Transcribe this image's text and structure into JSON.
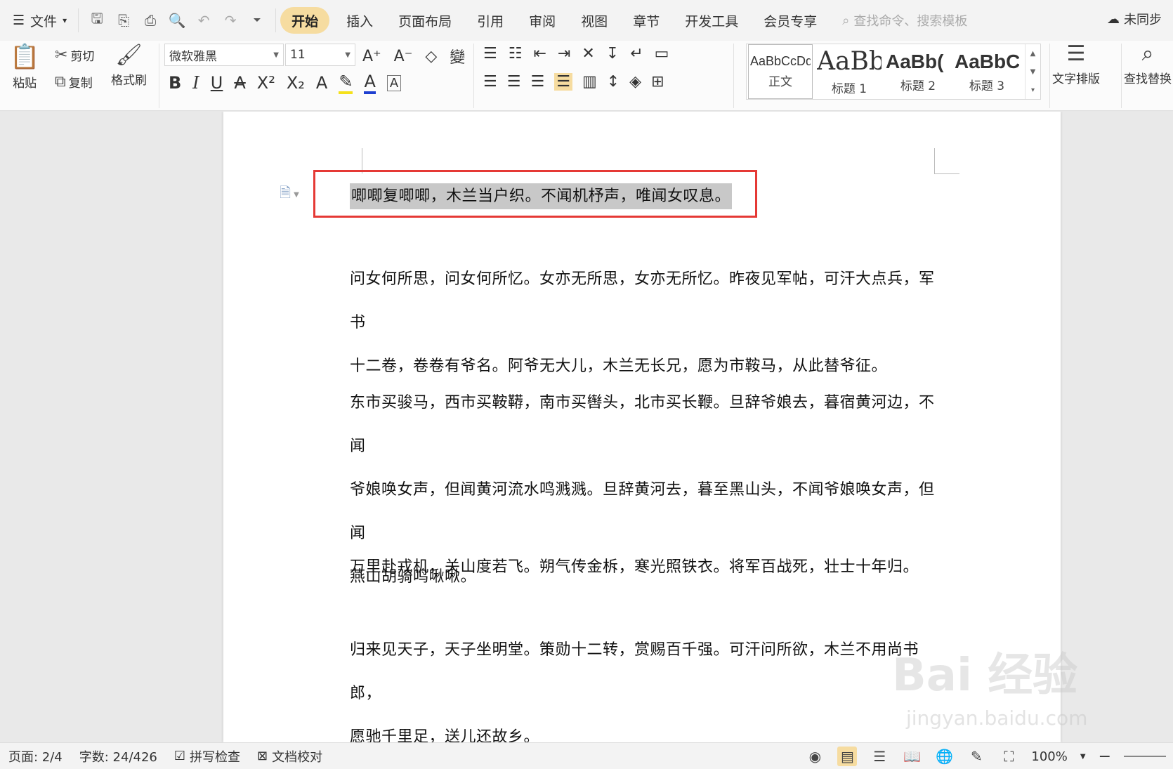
{
  "menubar": {
    "file": "文件",
    "tabs": [
      "开始",
      "插入",
      "页面布局",
      "引用",
      "审阅",
      "视图",
      "章节",
      "开发工具",
      "会员专享"
    ],
    "active_tab": "开始",
    "search_placeholder": "查找命令、搜索模板",
    "sync": "未同步"
  },
  "ribbon": {
    "paste": "粘贴",
    "cut": "剪切",
    "copy": "复制",
    "format_painter": "格式刷",
    "font_name": "微软雅黑",
    "font_size": "11",
    "styles": [
      {
        "sample": "AaBbCcDd",
        "name": "正文"
      },
      {
        "sample": "AaBb",
        "name": "标题 1"
      },
      {
        "sample": "AaBb(",
        "name": "标题 2"
      },
      {
        "sample": "AaBbC",
        "name": "标题 3"
      }
    ],
    "text_layout": "文字排版",
    "find_replace": "查找替换"
  },
  "document": {
    "paragraphs": [
      [
        "唧唧复唧唧，木兰当户织。不闻机杼声，唯闻女叹息。"
      ],
      [
        "问女何所思，问女何所忆。女亦无所思，女亦无所忆。昨夜见军帖，可汗大点兵，军书",
        "十二卷，卷卷有爷名。阿爷无大儿，木兰无长兄，愿为市鞍马，从此替爷征。"
      ],
      [
        "东市买骏马，西市买鞍鞯，南市买辔头，北市买长鞭。旦辞爷娘去，暮宿黄河边，不闻",
        "爷娘唤女声，但闻黄河流水鸣溅溅。旦辞黄河去，暮至黑山头，不闻爷娘唤女声，但闻",
        "燕山胡骑鸣啾啾。"
      ],
      [
        "万里赴戎机，关山度若飞。朔气传金柝，寒光照铁衣。将军百战死，壮士十年归。"
      ],
      [
        "归来见天子，天子坐明堂。策勋十二转，赏赐百千强。可汗问所欲，木兰不用尚书郎，",
        "愿驰千里足，送儿还故乡。"
      ]
    ]
  },
  "status": {
    "page": "页面: 2/4",
    "words": "字数: 24/426",
    "spell_check": "拼写检查",
    "doc_proof": "文档校对",
    "zoom": "100%"
  },
  "watermark": {
    "brand": "Bai 经验",
    "url": "jingyan.baidu.com"
  },
  "colors": {
    "active_tab_bg": "#f6dca0",
    "selection_bg": "#c8c8c8",
    "annotation_box": "#e53935"
  }
}
